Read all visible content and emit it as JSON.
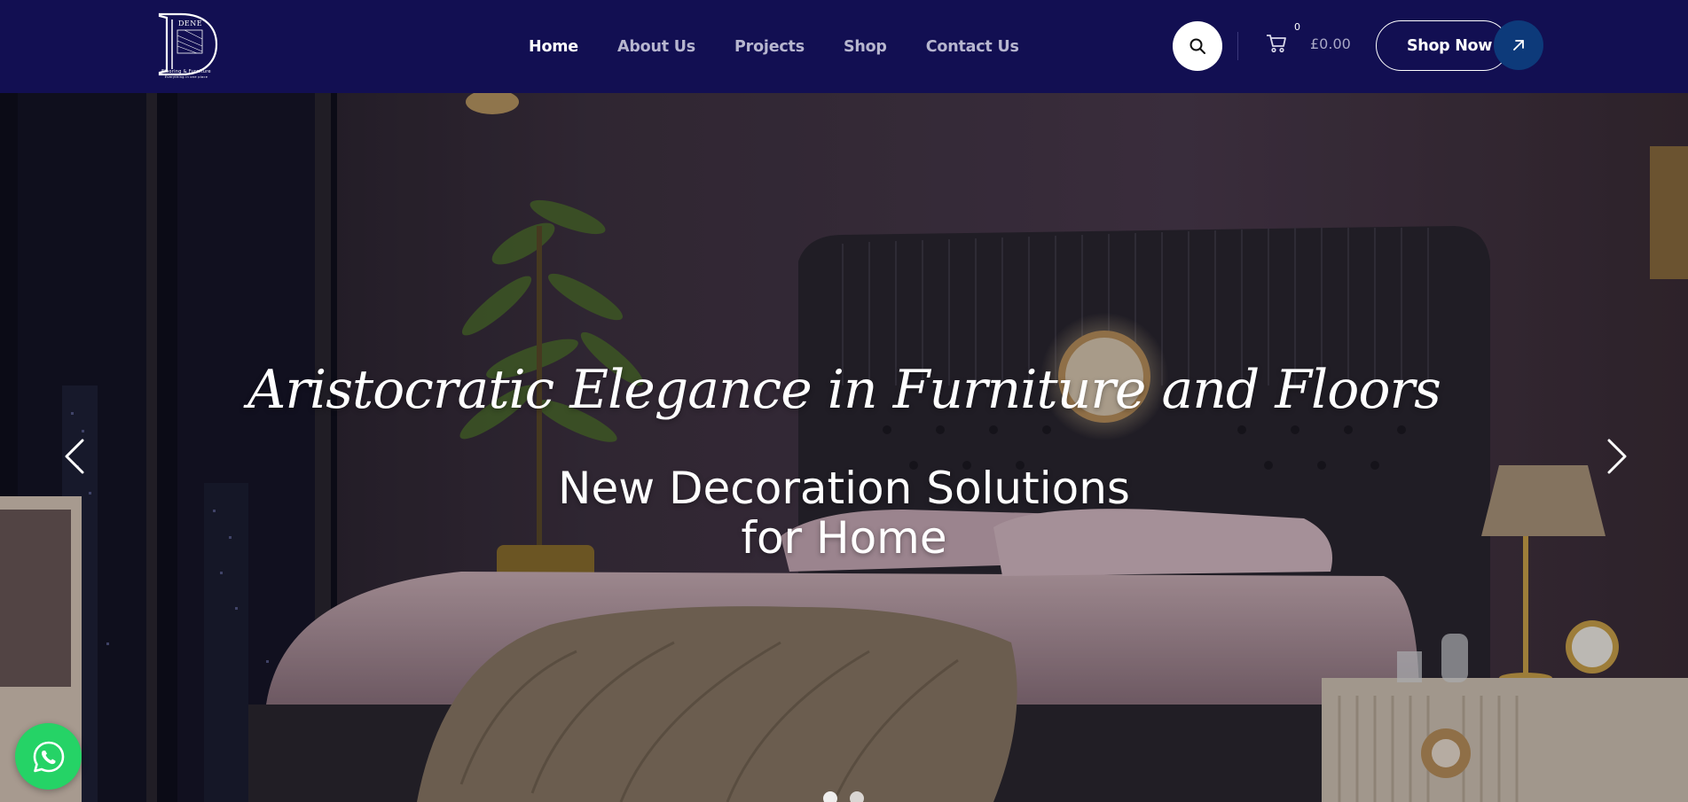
{
  "brand": {
    "logo_letter": "D",
    "logo_name": "DENE",
    "tagline": "Flooring & Furniture",
    "subtagline": "Everything in one place"
  },
  "nav": {
    "items": [
      {
        "label": "Home",
        "active": true
      },
      {
        "label": "About Us",
        "active": false
      },
      {
        "label": "Projects",
        "active": false
      },
      {
        "label": "Shop",
        "active": false
      },
      {
        "label": "Contact Us",
        "active": false
      }
    ]
  },
  "header_actions": {
    "search_icon": "search-icon",
    "cart_icon": "cart-icon",
    "cart_count": "0",
    "cart_total": "£0.00",
    "shop_now_label": "Shop Now",
    "shop_now_icon": "arrow-up-right-icon"
  },
  "hero": {
    "script_heading": "Aristocratic Elegance in Furniture and Floors",
    "title_line1": "New Decoration Solutions",
    "title_line2": "for Home",
    "prev_icon": "chevron-left-icon",
    "next_icon": "chevron-right-icon",
    "slides": 2,
    "active_slide": 1
  },
  "floating": {
    "whatsapp_icon": "whatsapp-icon"
  },
  "colors": {
    "header_bg": "#120f52",
    "nav_active": "#ffffff",
    "nav_inactive": "#b7b6cf",
    "accent_circle": "#0d3a7a",
    "whatsapp": "#25d366"
  }
}
